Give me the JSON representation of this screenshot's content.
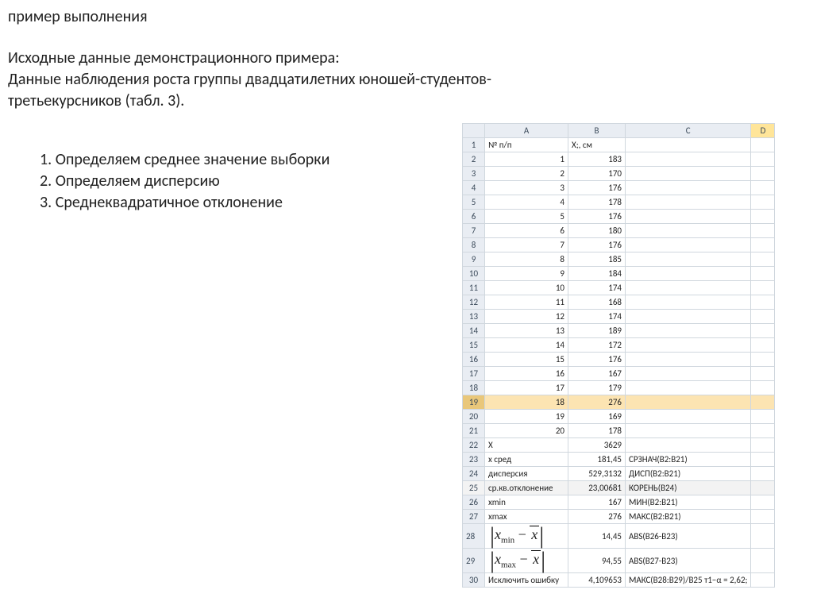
{
  "heading": "пример выполнения",
  "intro1": "Исходные данные демонстрационного примера:",
  "intro2": "Данные  наблюдения  роста  группы  двадцатилетних  юношей-студентов-третьекурсников (табл. 3).",
  "list": {
    "i1": "Определяем среднее значение выборки",
    "i2": "Определяем дисперсию",
    "i3": "Среднеквадратичное отклонение"
  },
  "sheet": {
    "cols": {
      "A": "A",
      "B": "B",
      "C": "C",
      "D": "D"
    },
    "hdr": {
      "A": "№ п/п",
      "B": "X;, см"
    },
    "rows": [
      {
        "r": "2",
        "n": "1",
        "v": "183"
      },
      {
        "r": "3",
        "n": "2",
        "v": "170"
      },
      {
        "r": "4",
        "n": "3",
        "v": "176"
      },
      {
        "r": "5",
        "n": "4",
        "v": "178"
      },
      {
        "r": "6",
        "n": "5",
        "v": "176"
      },
      {
        "r": "7",
        "n": "6",
        "v": "180"
      },
      {
        "r": "8",
        "n": "7",
        "v": "176"
      },
      {
        "r": "9",
        "n": "8",
        "v": "185"
      },
      {
        "r": "10",
        "n": "9",
        "v": "184"
      },
      {
        "r": "11",
        "n": "10",
        "v": "174"
      },
      {
        "r": "12",
        "n": "11",
        "v": "168"
      },
      {
        "r": "13",
        "n": "12",
        "v": "174"
      },
      {
        "r": "14",
        "n": "13",
        "v": "189"
      },
      {
        "r": "15",
        "n": "14",
        "v": "172"
      },
      {
        "r": "16",
        "n": "15",
        "v": "176"
      },
      {
        "r": "17",
        "n": "16",
        "v": "167"
      },
      {
        "r": "18",
        "n": "17",
        "v": "179"
      },
      {
        "r": "19",
        "n": "18",
        "v": "276"
      },
      {
        "r": "20",
        "n": "19",
        "v": "169"
      },
      {
        "r": "21",
        "n": "20",
        "v": "178"
      }
    ],
    "stat": {
      "r22": {
        "r": "22",
        "A": "X",
        "B": "3629",
        "C": ""
      },
      "r23": {
        "r": "23",
        "A": "x сред",
        "B": "181,45",
        "C": "СРЗНАЧ(B2:B21)"
      },
      "r24": {
        "r": "24",
        "A": "дисперсия",
        "B": "529,3132",
        "C": "ДИСП(B2:B21)"
      },
      "r25": {
        "r": "25",
        "A": "ср.кв.отклонение",
        "B": "23,00681",
        "C": "КОРЕНЬ(B24)"
      },
      "r26": {
        "r": "26",
        "A": "xmin",
        "B": "167",
        "C": "МИН(B2:B21)"
      },
      "r27": {
        "r": "27",
        "A": "xmax",
        "B": "276",
        "C": "МАКС(B2:B21)"
      },
      "r28": {
        "r": "28",
        "sub": "min",
        "B": "14,45",
        "C": "ABS(B26-B23)"
      },
      "r29": {
        "r": "29",
        "sub": "max",
        "B": "94,55",
        "C": "ABS(B27-B23)"
      },
      "r30": {
        "r": "30",
        "A": "Исключить ошибку",
        "B": "4,109653",
        "C": "МАКС(B28:B29)/B25 т1−α = 2,62;"
      }
    },
    "formula": {
      "x": "x",
      "xbar": "x",
      "minus": " − "
    }
  }
}
